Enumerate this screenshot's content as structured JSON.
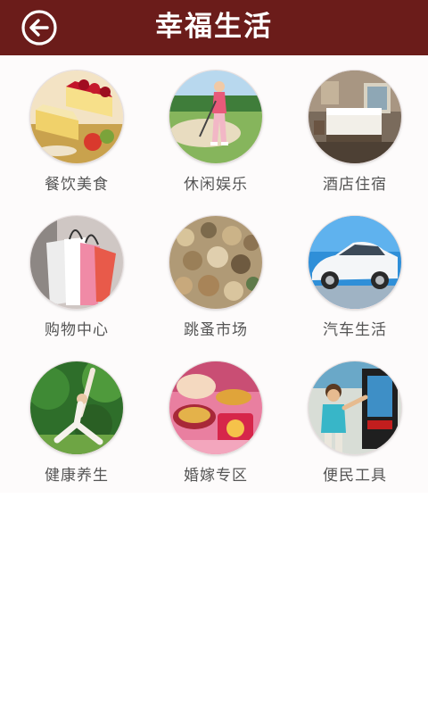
{
  "header": {
    "title": "幸福生活",
    "back_icon": "back-arrow-circle-icon",
    "background": "#6b1c1a"
  },
  "categories": [
    {
      "label": "餐饮美食",
      "icon": "food-photo"
    },
    {
      "label": "休闲娱乐",
      "icon": "golf-photo"
    },
    {
      "label": "酒店住宿",
      "icon": "hotel-room-photo"
    },
    {
      "label": "购物中心",
      "icon": "shopping-bags-photo"
    },
    {
      "label": "跳蚤市场",
      "icon": "flea-market-photo"
    },
    {
      "label": "汽车生活",
      "icon": "car-photo"
    },
    {
      "label": "健康养生",
      "icon": "yoga-photo"
    },
    {
      "label": "婚嫁专区",
      "icon": "wedding-photo"
    },
    {
      "label": "便民工具",
      "icon": "kiosk-photo"
    }
  ]
}
